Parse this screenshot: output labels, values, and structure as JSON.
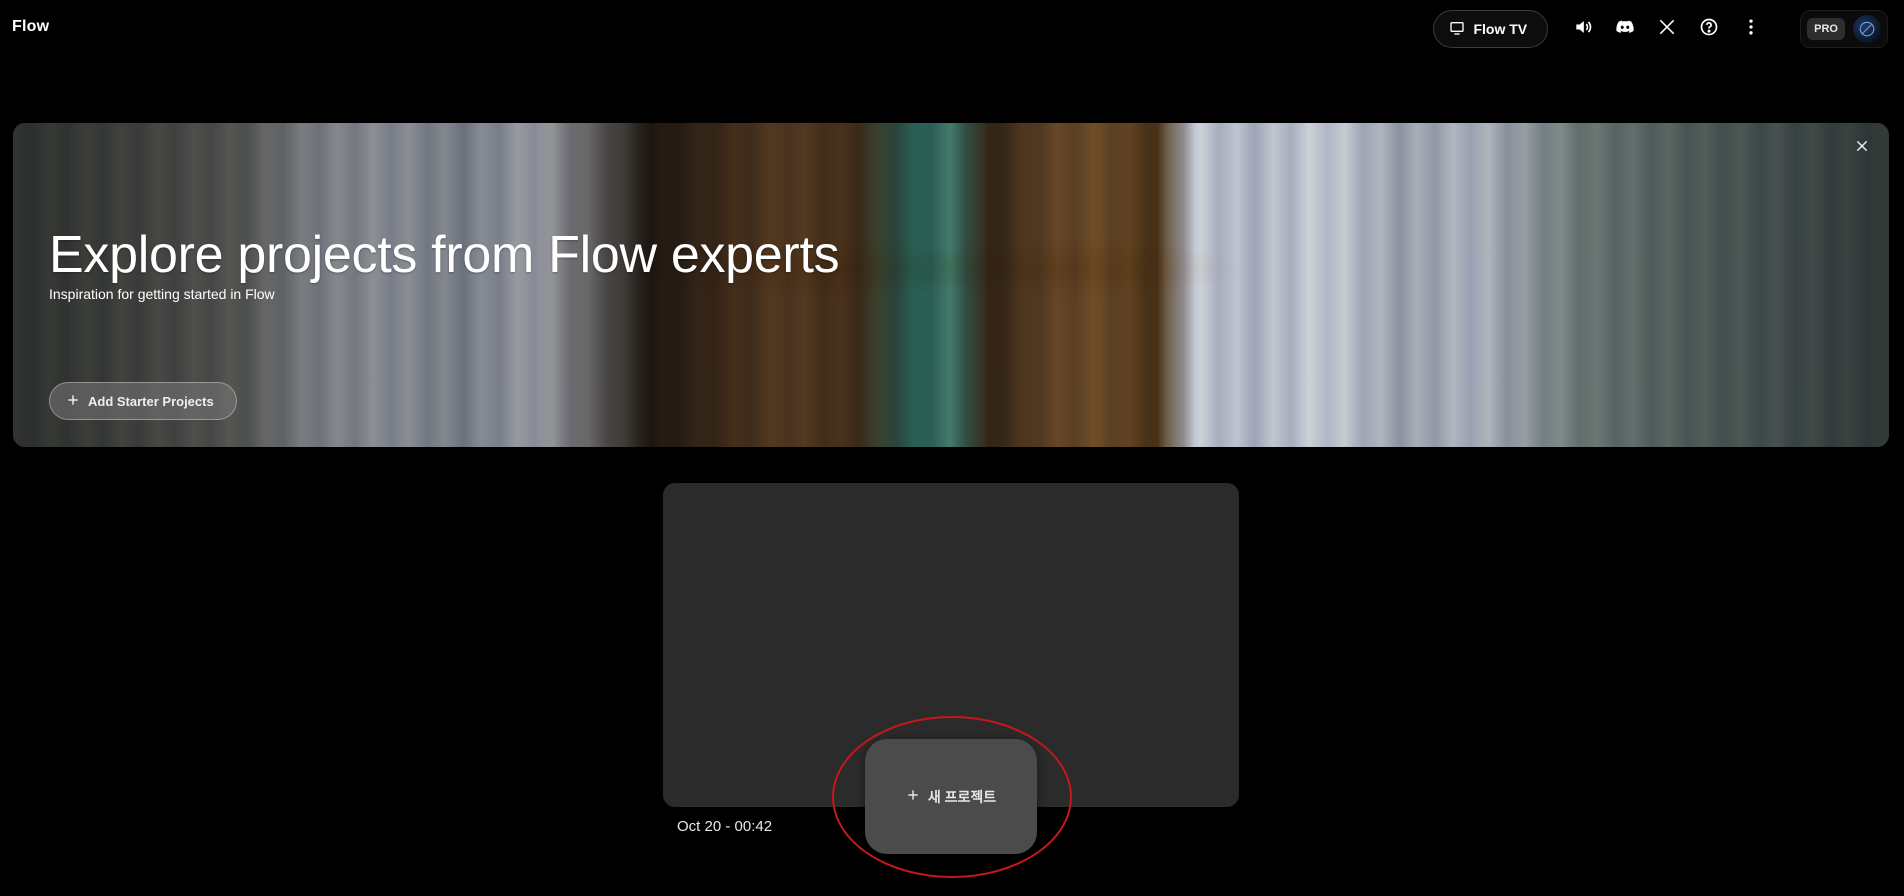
{
  "header": {
    "app_title": "Flow",
    "flow_tv_label": "Flow TV",
    "pro_badge": "PRO",
    "icons": [
      "tv-icon",
      "volume-icon",
      "discord-icon",
      "x-icon",
      "help-icon",
      "more-vert-icon",
      "avatar"
    ]
  },
  "banner": {
    "title": "Explore projects from Flow experts",
    "subtitle": "Inspiration for getting started in Flow",
    "starter_button_label": "Add Starter Projects"
  },
  "projects": [
    {
      "date": "Oct 20 - 00:42"
    }
  ],
  "new_project": {
    "label": "새 프로젝트"
  },
  "colors": {
    "background": "#000000",
    "card": "#2b2b2b",
    "new_project_button": "#4b4b4b",
    "highlight_ring": "#c4181d"
  }
}
